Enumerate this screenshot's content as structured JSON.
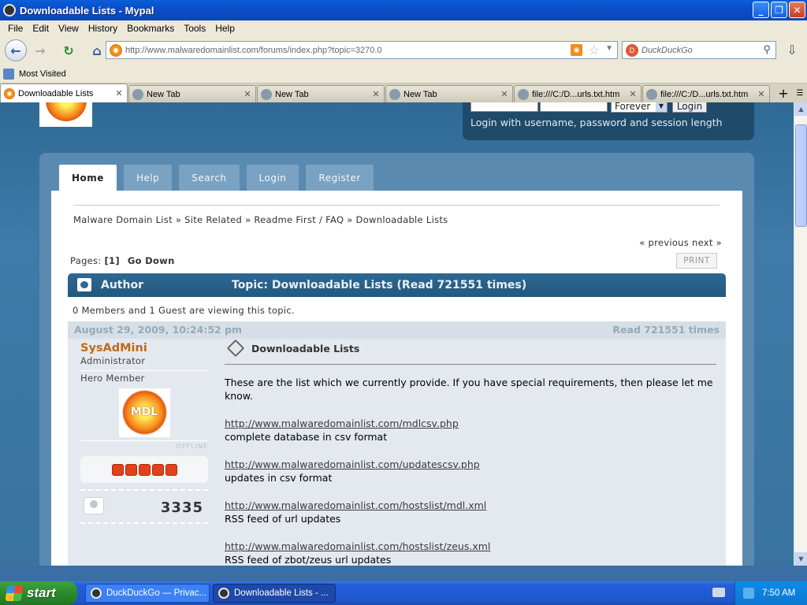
{
  "window": {
    "title": "Downloadable Lists - Mypal",
    "min_btn": "_",
    "max_btn": "❐",
    "close_btn": "✕"
  },
  "menu": [
    "File",
    "Edit",
    "View",
    "History",
    "Bookmarks",
    "Tools",
    "Help"
  ],
  "nav": {
    "url": "http://www.malwaredomainlist.com/forums/index.php?topic=3270.0",
    "search_placeholder": "DuckDuckGo"
  },
  "bookmarks": {
    "most_visited": "Most Visited"
  },
  "tabs": [
    {
      "label": "Downloadable Lists",
      "active": true
    },
    {
      "label": "New Tab",
      "active": false
    },
    {
      "label": "New Tab",
      "active": false
    },
    {
      "label": "New Tab",
      "active": false
    },
    {
      "label": "file:///C:/D...urls.txt.htm",
      "active": false
    },
    {
      "label": "file:///C:/D...urls.txt.htm",
      "active": false
    }
  ],
  "header": {
    "login_select": "Forever",
    "login_button": "Login",
    "login_hint": "Login with username, password and session length",
    "logo_text": "MDL"
  },
  "forum_nav": [
    "Home",
    "Help",
    "Search",
    "Login",
    "Register"
  ],
  "breadcrumb": "Malware Domain List » Site Related » Readme First / FAQ » Downloadable Lists",
  "pagination": {
    "prevnext": "« previous next »",
    "pages_label": "Pages:",
    "current": "[1]",
    "go_down": "Go Down",
    "print": "PRINT"
  },
  "topic_bar": {
    "author": "Author",
    "topic": "Topic: Downloadable Lists  (Read 721551 times)"
  },
  "viewing": "0 Members and 1 Guest are viewing this topic.",
  "post": {
    "date": "August 29, 2009, 10:24:52 pm",
    "reads": "Read 721551 times",
    "poster_name": "SysAdMini",
    "poster_role": "Administrator",
    "poster_group": "Hero Member",
    "avatar_text": "MDL",
    "status": "OFFLINE",
    "stars": 5,
    "post_count": "3335",
    "subject": "Downloadable Lists",
    "intro": "These are the list which we currently provide. If you have special requirements, then please let me know.",
    "items": [
      {
        "link": "http://www.malwaredomainlist.com/mdlcsv.php",
        "desc": "complete database in csv format"
      },
      {
        "link": "http://www.malwaredomainlist.com/updatescsv.php",
        "desc": "updates in csv format"
      },
      {
        "link": "http://www.malwaredomainlist.com/hostslist/mdl.xml",
        "desc": "RSS feed of url updates"
      },
      {
        "link": "http://www.malwaredomainlist.com/hostslist/zeus.xml",
        "desc": "RSS feed of zbot/zeus url updates"
      }
    ]
  },
  "taskbar": {
    "start": "start",
    "task1": "DuckDuckGo — Privac...",
    "task2": "Downloadable Lists - ...",
    "clock": "7:50 AM"
  }
}
